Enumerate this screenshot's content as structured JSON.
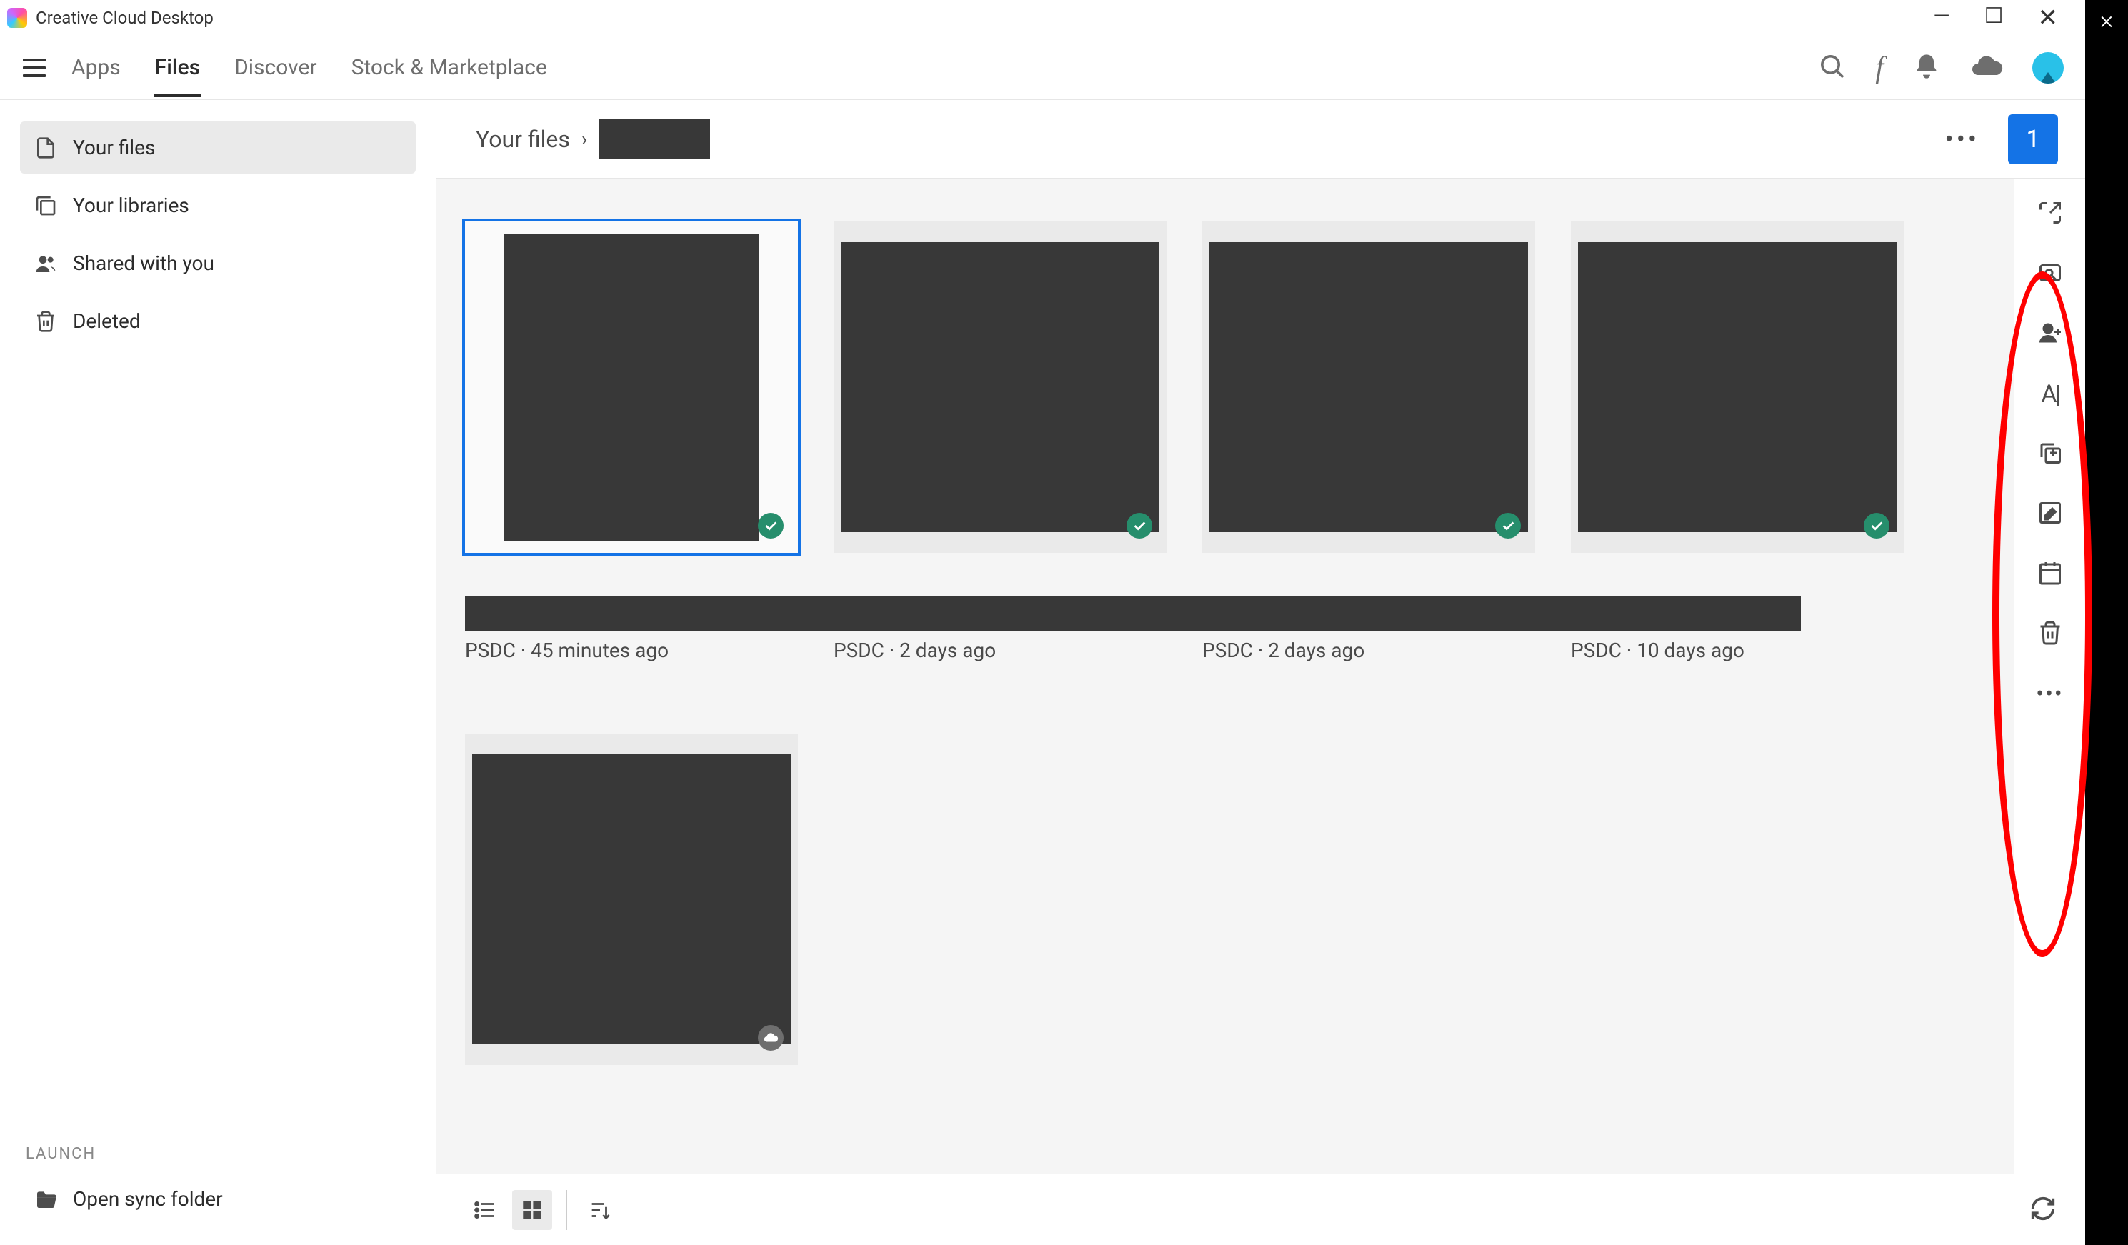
{
  "window": {
    "title": "Creative Cloud Desktop"
  },
  "nav": {
    "tabs": [
      "Apps",
      "Files",
      "Discover",
      "Stock & Marketplace"
    ],
    "active_index": 1
  },
  "sidebar": {
    "items": [
      {
        "label": "Your files",
        "icon": "file-icon"
      },
      {
        "label": "Your libraries",
        "icon": "libraries-icon"
      },
      {
        "label": "Shared with you",
        "icon": "people-icon"
      },
      {
        "label": "Deleted",
        "icon": "trash-icon"
      }
    ],
    "active_index": 0,
    "launch_label": "LAUNCH",
    "open_sync_label": "Open sync folder"
  },
  "header": {
    "breadcrumb_root": "Your files",
    "selected_count": "1"
  },
  "files": {
    "row1": [
      {
        "meta": "PSDC · 45 minutes ago",
        "synced": true,
        "selected": true
      },
      {
        "meta": "PSDC · 2 days ago",
        "synced": true,
        "selected": false
      },
      {
        "meta": "PSDC · 2 days ago",
        "synced": true,
        "selected": false
      },
      {
        "meta": "PSDC · 10 days ago",
        "synced": true,
        "selected": false
      }
    ],
    "row2": [
      {
        "meta": "",
        "synced": false,
        "cloud": true,
        "selected": false
      }
    ]
  },
  "right_rail": {
    "items": [
      "open-icon",
      "preview-icon",
      "add-people-icon",
      "rename-icon",
      "copy-icon",
      "edit-icon",
      "version-history-icon",
      "delete-icon"
    ]
  }
}
